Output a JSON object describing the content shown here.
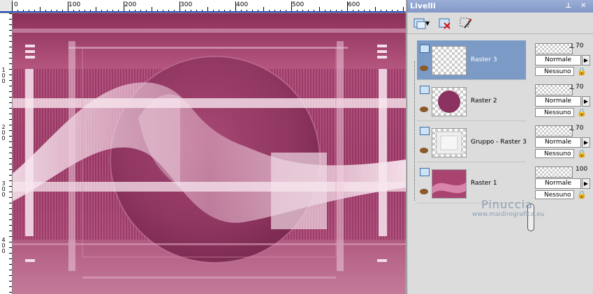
{
  "ruler": {
    "top_labels": [
      "0",
      "100",
      "200",
      "300",
      "400",
      "500",
      "600"
    ],
    "left_labels": [
      "1 0 0",
      "2 0 0",
      "3 0 0",
      "4 0 0"
    ]
  },
  "panel": {
    "title": "Livelli",
    "controls": [
      "pin-icon",
      "close-icon"
    ],
    "toolbar": [
      "new-raster-layer-icon",
      "chevron-down-icon",
      "delete-layer-icon",
      "edit-selection-icon"
    ]
  },
  "layers": [
    {
      "name": "Raster 3",
      "opacity": "70",
      "blend": "Normale",
      "lock": "Nessuno",
      "selected": true
    },
    {
      "name": "Raster 2",
      "opacity": "70",
      "blend": "Normale",
      "lock": "Nessuno",
      "selected": false
    },
    {
      "name": "Gruppo - Raster 3",
      "opacity": "70",
      "blend": "Normale",
      "lock": "Nessuno",
      "selected": false
    },
    {
      "name": "Raster 1",
      "opacity": "100",
      "blend": "Normale",
      "lock": "Nessuno",
      "selected": false
    }
  ],
  "watermark": {
    "title": "Pinuccia",
    "url": "www.maidiregrafica.eu"
  },
  "colors": {
    "canvas_main": "#a8446f",
    "canvas_dark": "#7a2a50",
    "stripe_light": "#f2dbe6",
    "panel_selected": "#7b9bc6"
  }
}
